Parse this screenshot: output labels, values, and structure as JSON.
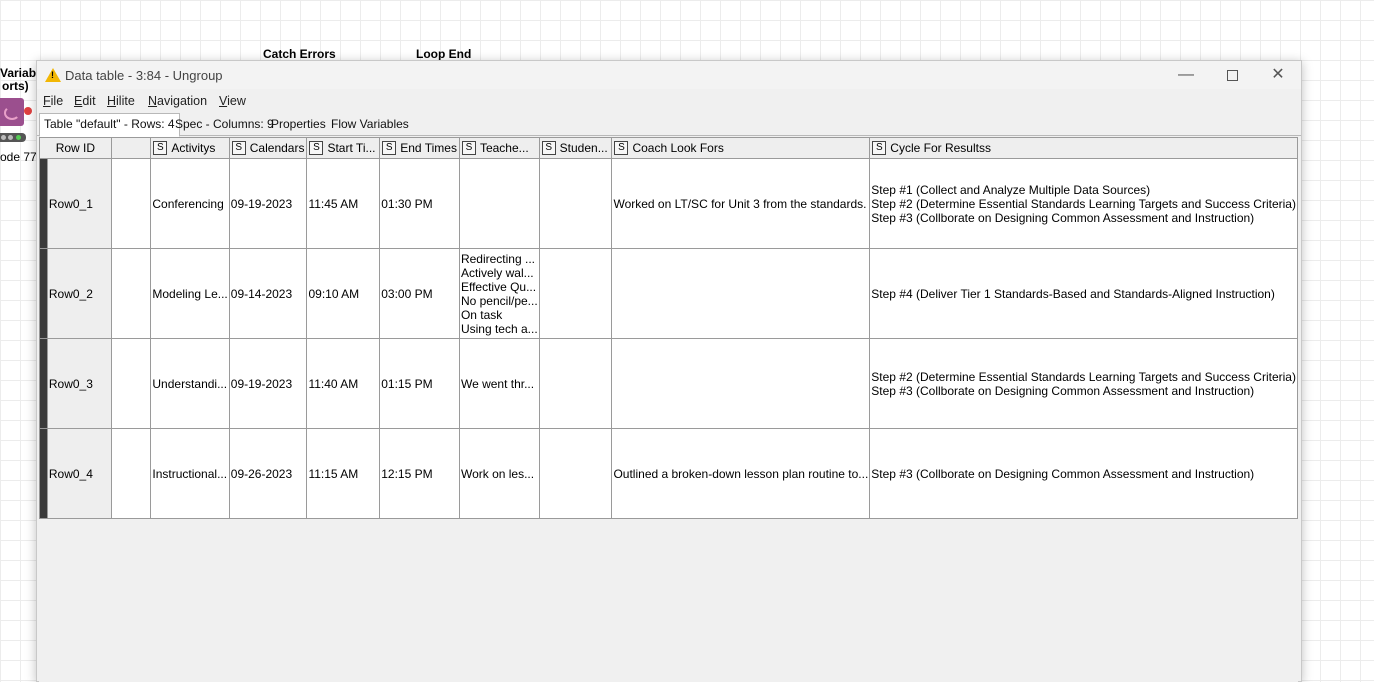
{
  "canvas": {
    "node_label_partial_1": "Variabl",
    "node_label_partial_2": "orts)",
    "node_label_partial_3": "ode 77",
    "catch_errors_label": "Catch Errors",
    "loop_end_label": "Loop End"
  },
  "window": {
    "title": "Data table - 3:84 - Ungroup",
    "warning_color": "#f2b705"
  },
  "menu": [
    {
      "first": "F",
      "rest": "ile"
    },
    {
      "first": "E",
      "rest": "dit"
    },
    {
      "first": "H",
      "rest": "ilite"
    },
    {
      "first": "N",
      "rest": "avigation"
    },
    {
      "first": "V",
      "rest": "iew"
    }
  ],
  "tabs": [
    {
      "label": "Table \"default\" - Rows: 4",
      "active": true
    },
    {
      "label": "Spec - Columns: 9",
      "active": false
    },
    {
      "label": "Properties",
      "active": false
    },
    {
      "label": "Flow Variables",
      "active": false
    }
  ],
  "table": {
    "columns": [
      {
        "label": "Row ID",
        "type": ""
      },
      {
        "label": "",
        "type": ""
      },
      {
        "label": "Activitys",
        "type": "S"
      },
      {
        "label": "Calendars",
        "type": "S"
      },
      {
        "label": "Start Ti...",
        "type": "S"
      },
      {
        "label": "End Times",
        "type": "S"
      },
      {
        "label": "Teache...",
        "type": "S"
      },
      {
        "label": "Studen...",
        "type": "S"
      },
      {
        "label": "Coach Look Fors",
        "type": "S"
      },
      {
        "label": "Cycle For Resultss",
        "type": "S"
      }
    ],
    "rows": [
      {
        "id": "Row0_1",
        "activity": "Conferencing",
        "calendar": "09-19-2023",
        "start": "11:45 AM",
        "end": "01:30 PM",
        "teacher": [],
        "student": [],
        "coach": "Worked on LT/SC for Unit 3 from the standards.",
        "cycle": [
          "Step #1 (Collect and Analyze Multiple Data Sources)",
          "Step #2 (Determine Essential Standards Learning Targets and Success Criteria)",
          "Step #3 (Collborate on Designing Common Assessment and Instruction)"
        ]
      },
      {
        "id": "Row0_2",
        "activity": "Modeling Le...",
        "calendar": "09-14-2023",
        "start": "09:10 AM",
        "end": "03:00 PM",
        "teacher": [
          "Redirecting ...",
          "Actively wal...",
          "Effective Qu...",
          "No pencil/pe...",
          "On task",
          "Using tech a..."
        ],
        "student": [],
        "coach": "",
        "cycle": [
          "Step #4 (Deliver Tier 1 Standards-Based and Standards-Aligned Instruction)"
        ]
      },
      {
        "id": "Row0_3",
        "activity": "Understandi...",
        "calendar": "09-19-2023",
        "start": "11:40 AM",
        "end": "01:15 PM",
        "teacher": [
          "We went thr..."
        ],
        "student": [],
        "coach": "",
        "cycle": [
          "Step #2 (Determine Essential Standards Learning Targets and Success Criteria)",
          "Step #3 (Collborate on Designing Common Assessment and Instruction)"
        ]
      },
      {
        "id": "Row0_4",
        "activity": "Instructional...",
        "calendar": "09-26-2023",
        "start": "11:15 AM",
        "end": "12:15 PM",
        "teacher": [
          "Work on les..."
        ],
        "student": [],
        "coach": "Outlined a broken-down lesson plan routine to...",
        "cycle": [
          "Step #3 (Collborate on Designing Common Assessment and Instruction)"
        ]
      }
    ]
  }
}
